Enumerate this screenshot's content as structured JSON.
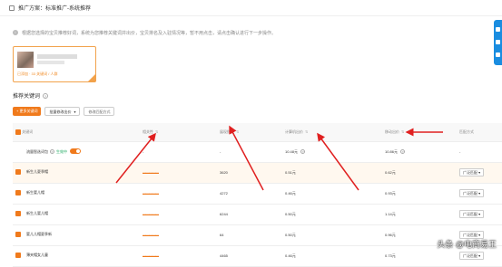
{
  "header": {
    "title": "推广方案：标准推广-系统推荐"
  },
  "notice": {
    "text": "根据您选择的宝贝推荐好词，系统为您推荐关键词并出价，宝贝排名及入驻情况等，暂不用点击，请点击确认进行下一步操作。"
  },
  "card": {
    "sub": "已添加 · 33 关键词 / 人群"
  },
  "section": {
    "title": "推荐关键词"
  },
  "toolbar": {
    "add_label": "+ 更多关键词",
    "select_value": "批量修改出价",
    "reset_label": "修改匹配方式"
  },
  "table": {
    "headers": [
      "关键词",
      "相关性",
      "展现指数",
      "计算机出价",
      "移动出价",
      "匹配方式"
    ],
    "smart_row": {
      "name": "流量智选词包",
      "status": "生效中",
      "relevance": "-",
      "index": "-",
      "pc_bid": "10.48元",
      "mobile_bid": "10.86元",
      "match": "-"
    },
    "rows": [
      {
        "keyword": "新生儿夏季帽",
        "index": "3620",
        "pc_bid": "0.51元",
        "mobile_bid": "0.62元",
        "match": "广泛匹配"
      },
      {
        "keyword": "新生婴儿帽",
        "index": "4272",
        "pc_bid": "0.46元",
        "mobile_bid": "0.93元",
        "match": "广泛匹配"
      },
      {
        "keyword": "新生儿婴儿帽",
        "index": "6244",
        "pc_bid": "0.50元",
        "mobile_bid": "1.14元",
        "match": "广泛匹配"
      },
      {
        "keyword": "婴儿儿帽夏季新",
        "index": "64",
        "pc_bid": "0.50元",
        "mobile_bid": "0.96元",
        "match": "广泛匹配"
      },
      {
        "keyword": "薄夹帽女儿童",
        "index": "4465",
        "pc_bid": "0.46元",
        "mobile_bid": "0.73元",
        "match": "广泛匹配"
      }
    ]
  },
  "colors": {
    "accent": "#f07a1c",
    "arrow": "#e02020",
    "side": "#1a8de0"
  },
  "watermark": {
    "text": "头条 @电商易王"
  }
}
